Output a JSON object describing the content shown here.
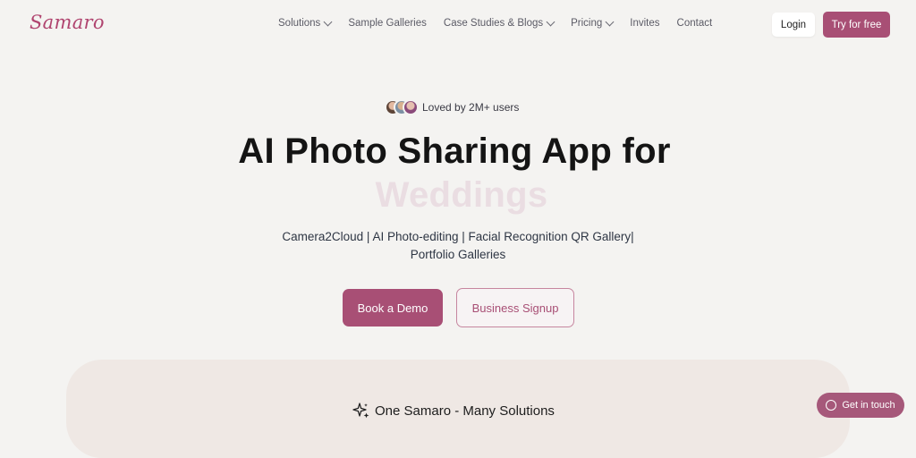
{
  "header": {
    "logo": "Samaro",
    "nav": [
      {
        "label": "Solutions",
        "dropdown": true
      },
      {
        "label": "Sample Galleries",
        "dropdown": false
      },
      {
        "label": "Case Studies & Blogs",
        "dropdown": true
      },
      {
        "label": "Pricing",
        "dropdown": true
      },
      {
        "label": "Invites",
        "dropdown": false
      },
      {
        "label": "Contact",
        "dropdown": false
      }
    ],
    "login_label": "Login",
    "try_label": "Try for free"
  },
  "hero": {
    "loved_text": "Loved by 2M+ users",
    "title": "AI Photo Sharing App for",
    "title_accent": "Weddings",
    "subtitle_line1": "Camera2Cloud | AI Photo-editing | Facial Recognition QR Gallery|",
    "subtitle_line2": "Portfolio Galleries",
    "demo_label": "Book a Demo",
    "business_label": "Business Signup"
  },
  "section": {
    "title": "One Samaro - Many Solutions"
  },
  "contact_button": {
    "label": "Get in touch"
  },
  "colors": {
    "brand": "#a84f75",
    "background": "#f4f3f1",
    "panel": "#efe8e4"
  },
  "icons": [
    "chevron-down-icon",
    "sparkle-icon",
    "whatsapp-icon"
  ]
}
